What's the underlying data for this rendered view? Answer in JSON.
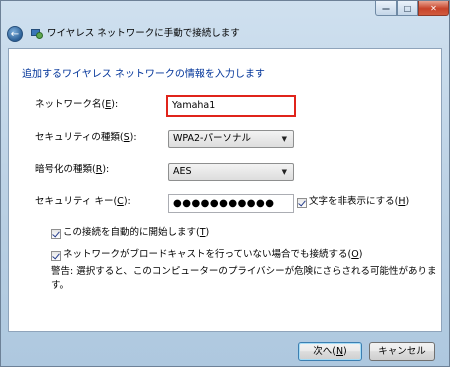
{
  "window": {
    "title": "ワイヤレス ネットワークに手動で接続します",
    "controls": {
      "minimize": "—",
      "maximize": "□",
      "close": "✕"
    },
    "back_glyph": "←"
  },
  "page": {
    "instruction": "追加するワイヤレス ネットワークの情報を入力します",
    "fields": {
      "network_name": {
        "label": "ネットワーク名(",
        "key": "E",
        "label_end": "):",
        "value": "Yamaha1"
      },
      "security_type": {
        "label": "セキュリティの種類(",
        "key": "S",
        "label_end": "):",
        "value": "WPA2-パーソナル"
      },
      "encryption_type": {
        "label": "暗号化の種類(",
        "key": "R",
        "label_end": "):",
        "value": "AES"
      },
      "security_key": {
        "label": "セキュリティ キー(",
        "key": "C",
        "label_end": "):",
        "value": "●●●●●●●●●●●"
      }
    },
    "hide_chars": {
      "label": "文字を非表示にする(",
      "key": "H",
      "label_end": ")",
      "checked": true
    },
    "auto_start": {
      "label": "この接続を自動的に開始します(",
      "key": "T",
      "label_end": ")",
      "checked": true
    },
    "connect_hidden": {
      "label": "ネットワークがブロードキャストを行っていない場合でも接続する(",
      "key": "O",
      "label_end": ")",
      "checked": true
    },
    "warning": "警告: 選択すると、このコンピューターのプライバシーが危険にさらされる可能性があります。"
  },
  "footer": {
    "next": {
      "label": "次へ(",
      "key": "N",
      "label_end": ")"
    },
    "cancel": "キャンセル"
  },
  "colors": {
    "instruction": "#003399",
    "highlight_border": "#e0241b"
  },
  "icons": {
    "back": "back-arrow-icon",
    "network": "network-globe-icon",
    "dropdown": "chevron-down-icon"
  }
}
